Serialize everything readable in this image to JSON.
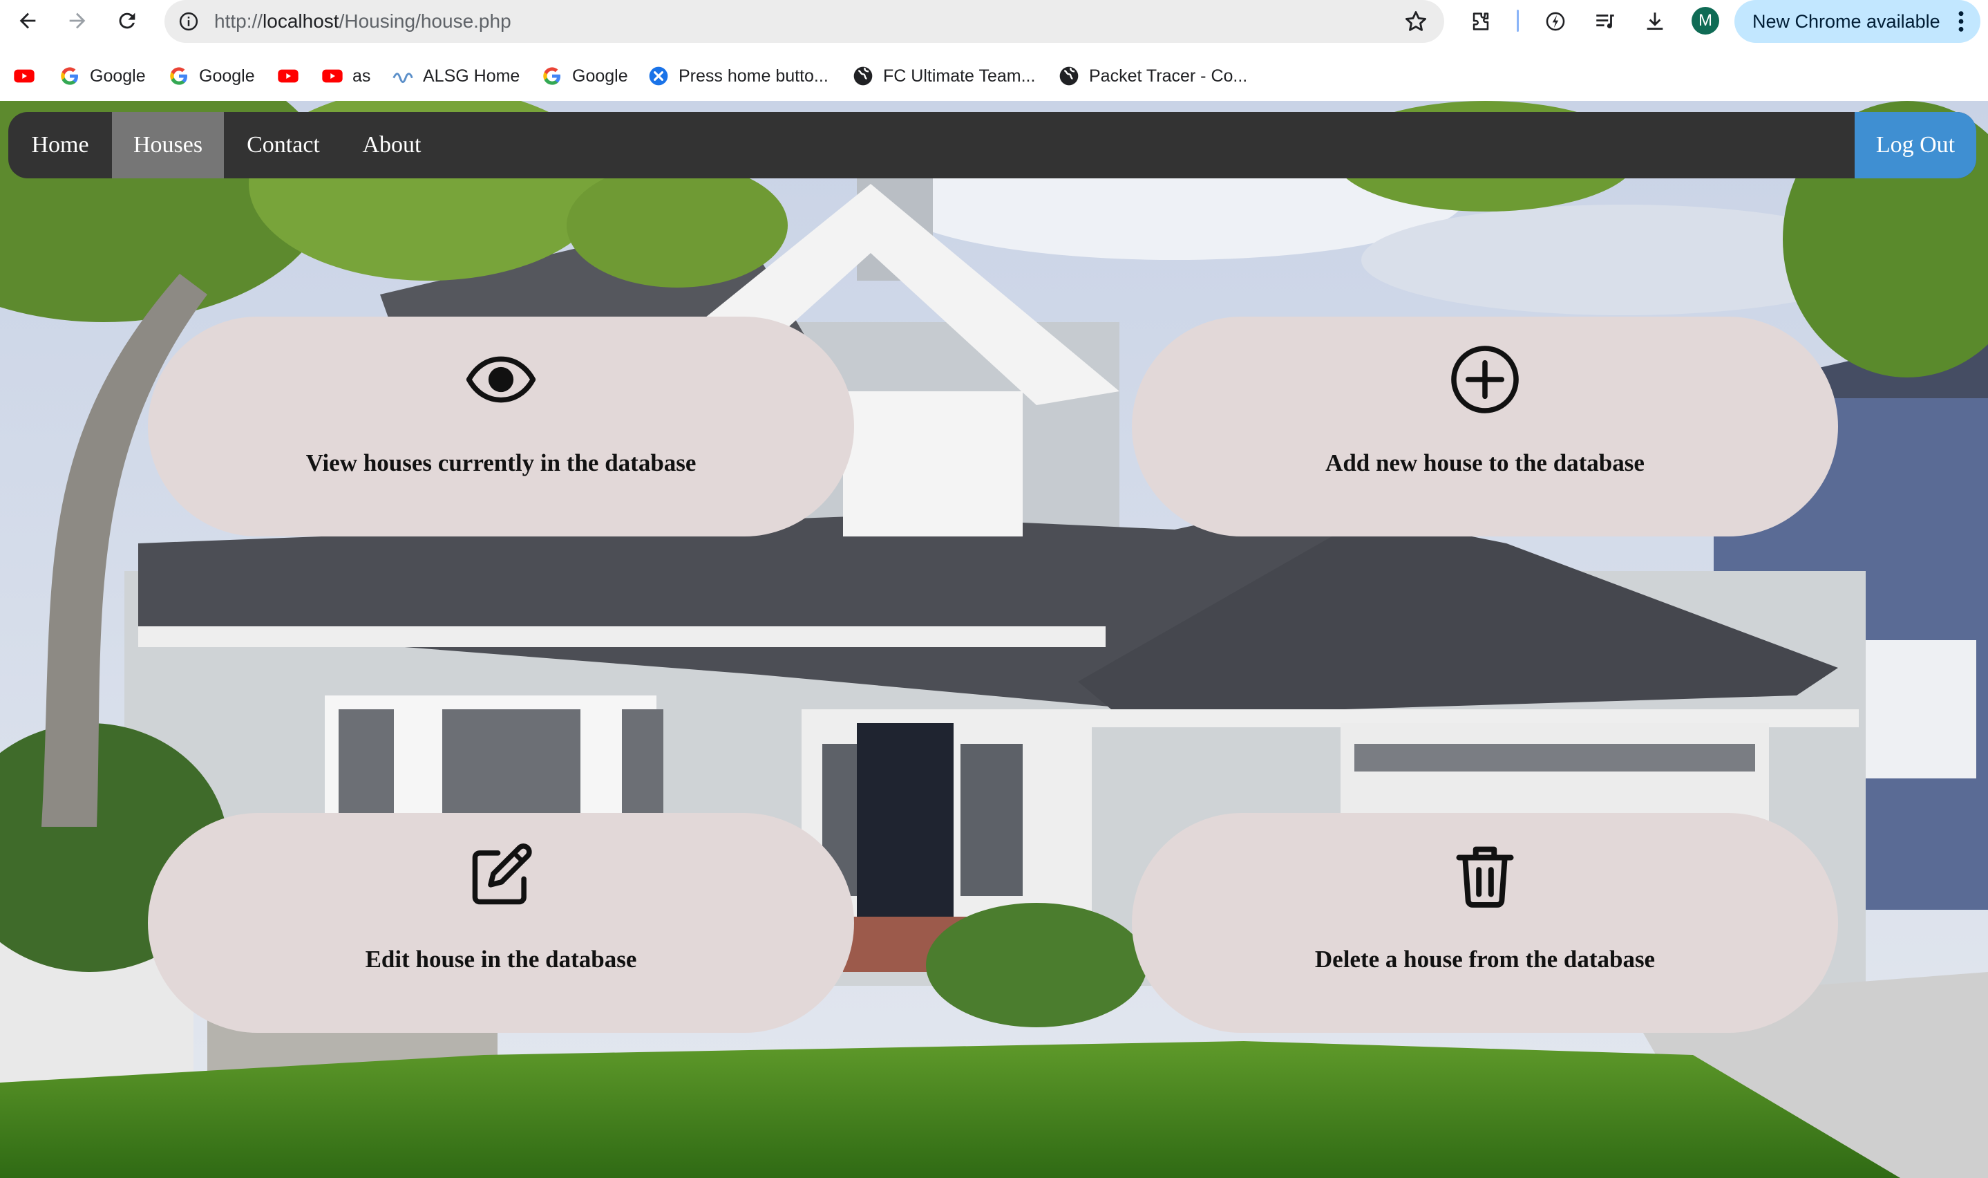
{
  "browser": {
    "url_scheme": "http://",
    "url_host": "localhost",
    "url_path": "/Housing/house.php",
    "profile_initial": "M",
    "update_label": "New Chrome available"
  },
  "bookmarks": [
    {
      "icon": "youtube-icon",
      "label": ""
    },
    {
      "icon": "google-icon",
      "label": "Google"
    },
    {
      "icon": "google-icon",
      "label": "Google"
    },
    {
      "icon": "youtube-icon",
      "label": ""
    },
    {
      "icon": "youtube-icon",
      "label": "as"
    },
    {
      "icon": "alsg-icon",
      "label": "ALSG Home"
    },
    {
      "icon": "google-icon",
      "label": "Google"
    },
    {
      "icon": "close-circle-icon",
      "label": "Press home butto..."
    },
    {
      "icon": "globe-icon",
      "label": "FC Ultimate Team..."
    },
    {
      "icon": "globe-icon",
      "label": "Packet Tracer - Co..."
    }
  ],
  "nav": {
    "home": "Home",
    "houses": "Houses",
    "contact": "Contact",
    "about": "About",
    "logout": "Log Out",
    "active": "Houses"
  },
  "cards": {
    "view": {
      "icon": "eye-icon",
      "label": "View houses currently in the database"
    },
    "add": {
      "icon": "plus-circle-icon",
      "label": "Add new house to the database"
    },
    "edit": {
      "icon": "edit-icon",
      "label": "Edit house in the database"
    },
    "delete": {
      "icon": "trash-icon",
      "label": "Delete a house from the database"
    }
  },
  "colors": {
    "navbar": "#333333",
    "nav_active": "#767676",
    "logout": "#3f8fd2",
    "card": "#e2d8d8",
    "update_pill": "#c2e7ff"
  }
}
